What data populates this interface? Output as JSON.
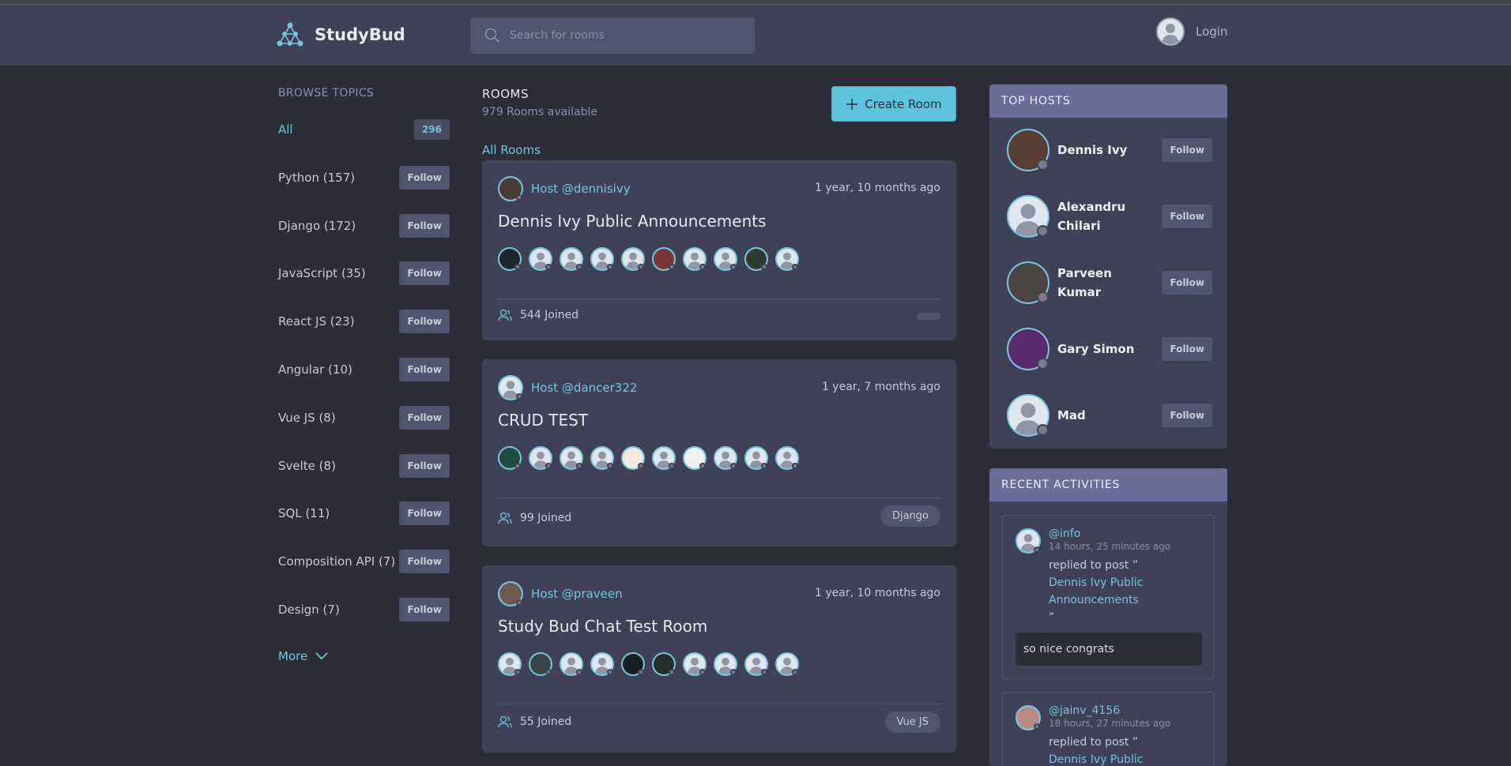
{
  "header": {
    "brand": "StudyBud",
    "search_placeholder": "Search for rooms",
    "login_label": "Login"
  },
  "topics": {
    "title": "BROWSE TOPICS",
    "all": {
      "label": "All",
      "count": "296"
    },
    "items": [
      {
        "label": "Python (157)",
        "follow": "Follow"
      },
      {
        "label": "Django (172)",
        "follow": "Follow"
      },
      {
        "label": "JavaScript (35)",
        "follow": "Follow"
      },
      {
        "label": "React JS (23)",
        "follow": "Follow"
      },
      {
        "label": "Angular (10)",
        "follow": "Follow"
      },
      {
        "label": "Vue JS (8)",
        "follow": "Follow"
      },
      {
        "label": "Svelte (8)",
        "follow": "Follow"
      },
      {
        "label": "SQL (11)",
        "follow": "Follow"
      },
      {
        "label": "Composition API (7)",
        "follow": "Follow"
      },
      {
        "label": "Design (7)",
        "follow": "Follow"
      }
    ],
    "more": "More"
  },
  "rooms": {
    "title": "ROOMS",
    "count": "979 Rooms available",
    "create_label": "Create Room",
    "all_rooms": "All Rooms",
    "cards": [
      {
        "host": "Host @dennisivy",
        "time": "1 year, 10 months ago",
        "title": "Dennis Ivy Public Announcements",
        "joined": "544 Joined",
        "tag": ""
      },
      {
        "host": "Host @dancer322",
        "time": "1 year, 7 months ago",
        "title": "CRUD TEST",
        "joined": "99 Joined",
        "tag": "Django"
      },
      {
        "host": "Host @praveen",
        "time": "1 year, 10 months ago",
        "title": "Study Bud Chat Test Room",
        "joined": "55 Joined",
        "tag": "Vue JS"
      }
    ]
  },
  "top_hosts": {
    "title": "TOP HOSTS",
    "items": [
      {
        "name": "Dennis Ivy",
        "follow": "Follow"
      },
      {
        "name": "Alexandru Chilari",
        "follow": "Follow"
      },
      {
        "name": "Parveen Kumar",
        "follow": "Follow"
      },
      {
        "name": "Gary Simon",
        "follow": "Follow"
      },
      {
        "name": "Mad",
        "follow": "Follow"
      }
    ]
  },
  "activities": {
    "title": "RECENT ACTIVITIES",
    "items": [
      {
        "user": "@info",
        "time": "14 hours, 25 minutes ago",
        "action": "replied to post ”",
        "post_line1": "Dennis Ivy Public",
        "post_line2": "Announcements",
        "close_quote": "”",
        "reply": "so nice congrats"
      },
      {
        "user": "@jainv_4156",
        "time": "18 hours, 27 minutes ago",
        "action": "replied to post ”",
        "post_line1": "Dennis Ivy Public"
      }
    ]
  },
  "colors": {
    "accent": "#71c6dd",
    "background": "#2d2d39",
    "panel": "#3f4156",
    "panel_header": "#696d97"
  }
}
